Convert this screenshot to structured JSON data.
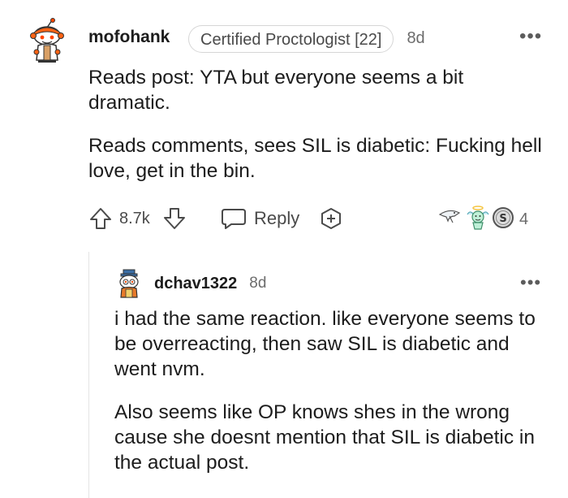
{
  "comment": {
    "author": "mofohank",
    "flair": "Certified Proctologist [22]",
    "time": "8d",
    "more": "•••",
    "paragraphs": [
      "Reads post: YTA but everyone seems a bit dramatic.",
      "Reads comments, sees SIL is diabetic: Fucking hell love, get in the bin."
    ],
    "actions": {
      "score": "8.7k",
      "reply_label": "Reply",
      "award_count": "4",
      "icons": [
        "upvote-icon",
        "downvote-icon",
        "chat-bubble-icon",
        "add-award-icon"
      ],
      "awards": [
        "shark-award-icon",
        "angel-award-icon",
        "silver-coin-award-icon"
      ]
    }
  },
  "reply": {
    "author": "dchav1322",
    "time": "8d",
    "more": "•••",
    "paragraphs": [
      "i had the same reaction. like everyone seems to be overreacting, then saw SIL is diabetic and went nvm.",
      "Also seems like OP knows shes in the wrong cause she doesnt mention that SIL is diabetic in the actual post."
    ]
  },
  "colors": {
    "text": "#1c1c1c",
    "meta": "#6b6b6b",
    "icon": "#4a4a4a",
    "thread_line": "#e4e4e4",
    "flair_border": "#d6d6d6"
  }
}
